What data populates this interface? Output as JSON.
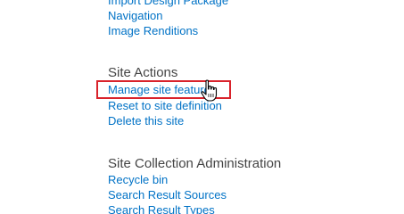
{
  "look_and_feel": {
    "items": [
      {
        "label": "Import Design Package"
      },
      {
        "label": "Navigation"
      },
      {
        "label": "Image Renditions"
      }
    ]
  },
  "site_actions": {
    "heading": "Site Actions",
    "items": [
      {
        "label": "Manage site features"
      },
      {
        "label": "Reset to site definition"
      },
      {
        "label": "Delete this site"
      }
    ]
  },
  "site_collection_admin": {
    "heading": "Site Collection Administration",
    "items": [
      {
        "label": "Recycle bin"
      },
      {
        "label": "Search Result Sources"
      },
      {
        "label": "Search Result Types"
      }
    ]
  },
  "colors": {
    "link": "#0072c6",
    "heading": "#444444",
    "highlight": "#d9232b"
  },
  "icons": {
    "pointer": "hand-pointer-icon"
  }
}
